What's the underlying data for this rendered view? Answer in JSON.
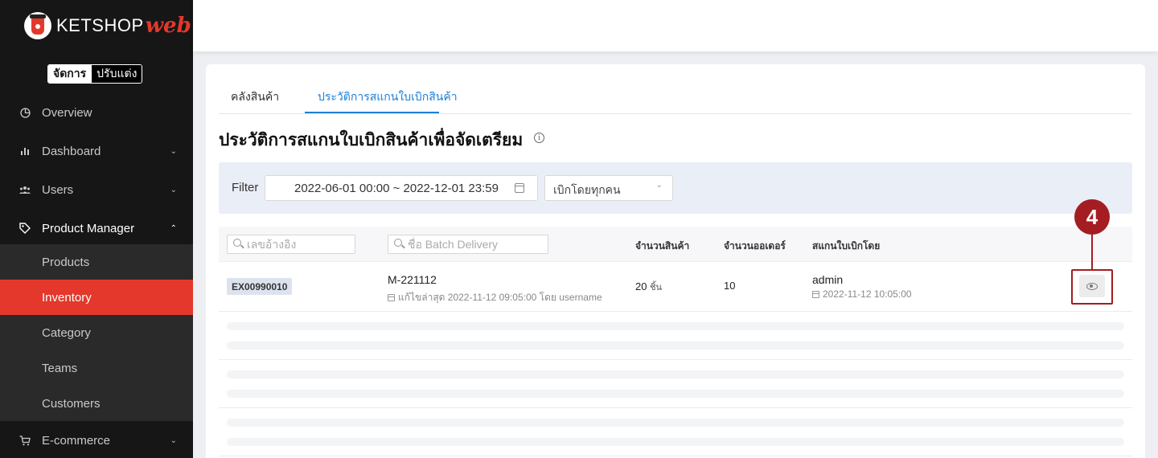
{
  "brand": {
    "name": "KETSHOP",
    "suffix": "web"
  },
  "mode_switch": {
    "active": "จัดการ",
    "inactive": "ปรับแต่ง"
  },
  "sidebar": {
    "items": [
      {
        "label": "Overview",
        "icon": "pie-icon"
      },
      {
        "label": "Dashboard",
        "icon": "bar-chart-icon",
        "expandable": true
      },
      {
        "label": "Users",
        "icon": "users-icon",
        "expandable": true
      },
      {
        "label": "Product Manager",
        "icon": "tag-icon",
        "expandable": true,
        "open": true
      },
      {
        "label": "E-commerce",
        "icon": "cart-icon",
        "expandable": true
      }
    ],
    "sub_items": [
      {
        "label": "Products"
      },
      {
        "label": "Inventory",
        "active": true
      },
      {
        "label": "Category"
      },
      {
        "label": "Teams"
      },
      {
        "label": "Customers"
      }
    ]
  },
  "tabs": [
    {
      "label": "คลังสินค้า"
    },
    {
      "label": "ประวัติการสแกนใบเบิกสินค้า",
      "active": true
    }
  ],
  "page_title": "ประวัติการสแกนใบเบิกสินค้าเพื่อจัดเตรียม",
  "filter": {
    "label": "Filter",
    "date_range": "2022-06-01 00:00 ~ 2022-12-01 23:59",
    "withdrawn_by": "เบิกโดยทุกคน"
  },
  "table": {
    "search_ref_placeholder": "เลขอ้างอิง",
    "search_batch_placeholder": "ชื่อ Batch Delivery",
    "headers": {
      "qty": "จำนวนสินค้า",
      "orders": "จำนวนออเดอร์",
      "scanned_by": "สแกนใบเบิกโดย"
    },
    "rows": [
      {
        "ref": "EX00990010",
        "batch": "M-221112",
        "edited": "แก้ไขล่าสุด 2022-11-12 09:05:00 โดย username",
        "qty": "20",
        "qty_unit": "ชิ้น",
        "orders": "10",
        "scanner": "admin",
        "scan_date": "2022-11-12 10:05:00"
      }
    ]
  },
  "callout": {
    "number": "4"
  },
  "colors": {
    "accent": "#e3382b",
    "link": "#1d7fd8",
    "callout": "#a31d22"
  }
}
